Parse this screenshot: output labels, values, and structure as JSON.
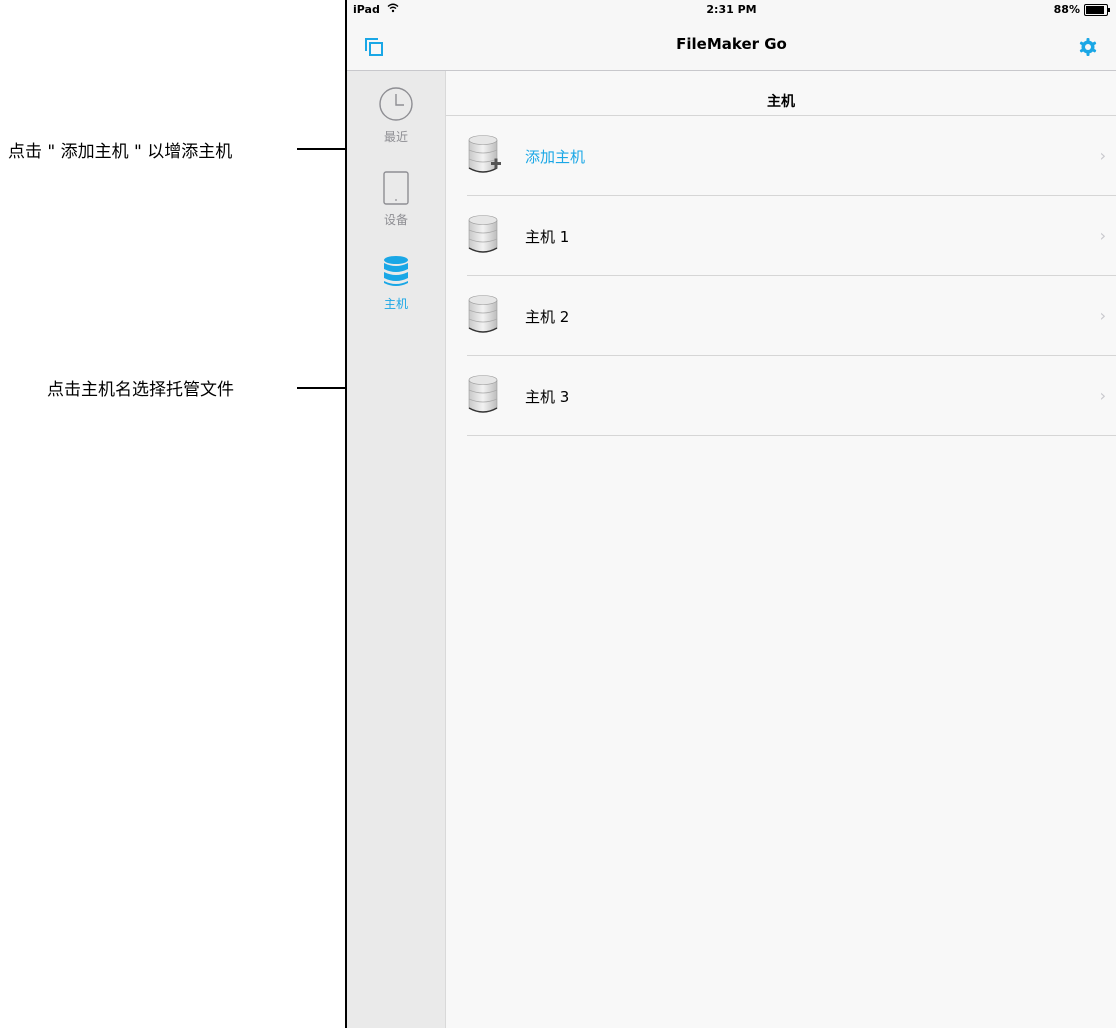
{
  "callouts": {
    "add_host": "点击 \" 添加主机 \" 以增添主机",
    "select_host": "点击主机名选择托管文件"
  },
  "status_bar": {
    "device": "iPad",
    "time": "2:31 PM",
    "battery": "88%",
    "battery_level": 0.88
  },
  "nav": {
    "title": "FileMaker Go"
  },
  "sidebar": {
    "tabs": [
      {
        "label": "最近",
        "icon": "clock-icon"
      },
      {
        "label": "设备",
        "icon": "ipad-icon"
      },
      {
        "label": "主机",
        "icon": "database-icon"
      }
    ]
  },
  "main": {
    "title": "主机",
    "rows": [
      {
        "label": "添加主机",
        "icon": "database-add-icon"
      },
      {
        "label": "主机 1",
        "icon": "database-icon"
      },
      {
        "label": "主机 2",
        "icon": "database-icon"
      },
      {
        "label": "主机 3",
        "icon": "database-icon"
      }
    ]
  },
  "colors": {
    "accent": "#1aa7e6",
    "chevron": "#c7c7cc"
  }
}
